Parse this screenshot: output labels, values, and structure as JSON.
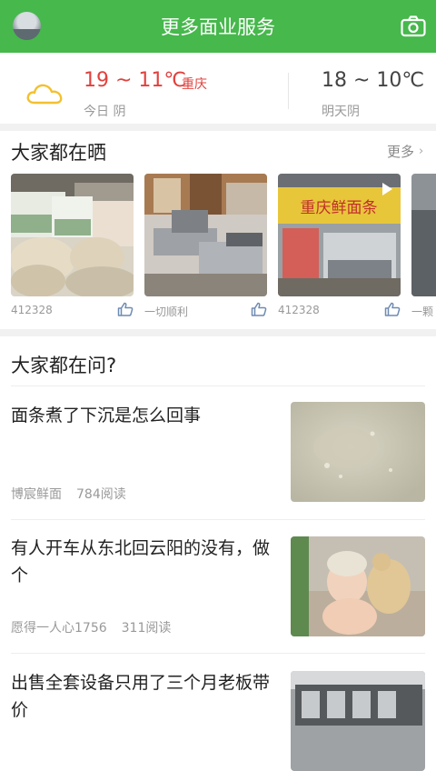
{
  "header": {
    "title": "更多面业服务"
  },
  "weather": {
    "today_temp": "19 ~ 11℃",
    "city": "重庆",
    "today_label": "今日 阴",
    "tomorrow_temp": "18 ~ 10℃",
    "tomorrow_label": "明天阴"
  },
  "showcase": {
    "title": "大家都在晒",
    "more": "更多",
    "items": [
      {
        "caption": "412328"
      },
      {
        "caption": "一切顺利"
      },
      {
        "caption": "412328",
        "shop_sign": "重庆鲜面条"
      },
      {
        "caption": "一颗"
      }
    ]
  },
  "questions": {
    "title": "大家都在问?",
    "items": [
      {
        "title": "面条煮了下沉是怎么回事",
        "author": "博宸鲜面",
        "reads": "784阅读"
      },
      {
        "title": "有人开车从东北回云阳的没有，做个",
        "author": "愿得一人心1756",
        "reads": "311阅读"
      },
      {
        "title": "出售全套设备只用了三个月老板带价",
        "author": "",
        "reads": ""
      }
    ]
  },
  "colors": {
    "brand": "#46b84c",
    "weather_today": "#e0413e",
    "muted": "#999999"
  },
  "icons": {
    "camera": "camera-icon",
    "weather": "cloud-icon",
    "like": "thumbs-up-icon",
    "play": "play-icon"
  }
}
